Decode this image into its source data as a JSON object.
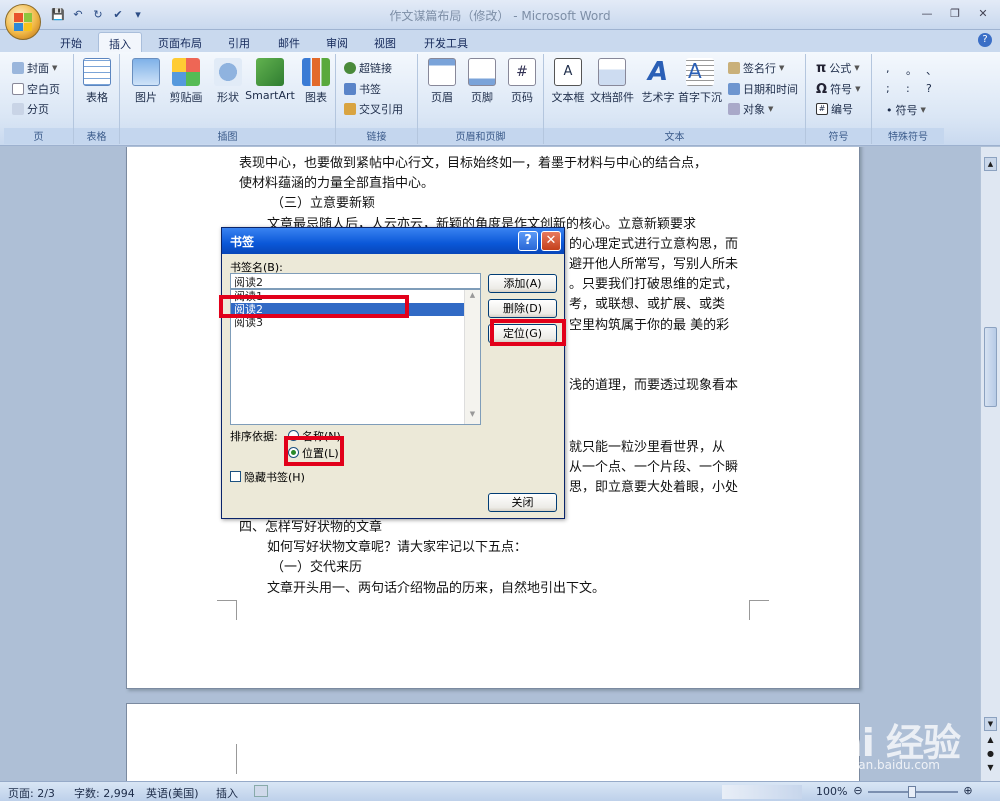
{
  "window": {
    "title": "作文谋篇布局（修改） - Microsoft Word"
  },
  "tabs": [
    "开始",
    "插入",
    "页面布局",
    "引用",
    "邮件",
    "审阅",
    "视图",
    "开发工具"
  ],
  "ribbon": {
    "page_group": {
      "label": "页",
      "items": [
        "封面",
        "空白页",
        "分页"
      ]
    },
    "table_group": {
      "label": "表格",
      "button": "表格"
    },
    "illustrations_group": {
      "label": "插图",
      "buttons": [
        "图片",
        "剪贴画",
        "形状",
        "SmartArt",
        "图表"
      ]
    },
    "links_group": {
      "label": "链接",
      "items": [
        "超链接",
        "书签",
        "交叉引用"
      ]
    },
    "header_footer_group": {
      "label": "页眉和页脚",
      "buttons": [
        "页眉",
        "页脚",
        "页码"
      ]
    },
    "text_group": {
      "label": "文本",
      "buttons": [
        "文本框",
        "文档部件",
        "艺术字",
        "首字下沉"
      ],
      "items": [
        "签名行",
        "日期和时间",
        "对象"
      ]
    },
    "symbols_group": {
      "label": "符号",
      "items": [
        "公式",
        "符号",
        "编号"
      ]
    },
    "special_group": {
      "label": "特殊符号",
      "chars": [
        ",",
        "。",
        "、",
        ";",
        ":",
        "?",
        "符号"
      ]
    }
  },
  "document": {
    "lines": [
      "表现中心，也要做到紧帖中心行文，目标始终如一，着墨于材料与中心的结合点，",
      "使材料蕴涵的力量全部直指中心。",
      "（三）立意要新颖",
      "文章最忌随人后，人云亦云，新颖的角度是作文创新的核心。立意新颖要求",
      "的心理定式进行立意构思，而",
      "避开他人所常写，写别人所未",
      "。只要我们打破思维的定式，",
      "考，或联想、或扩展、或类",
      "空里构筑属于你的最 美的彩",
      "浅的道理，而要透过现象看本",
      "就只能一粒沙里看世界，从",
      "从一个点、一个片段、一个瞬",
      "思，即立意要大处着眼，小处",
      "四、怎样写好状物的文章",
      "如何写好状物文章呢？请大家牢记以下五点：",
      "（一）交代来历",
      "文章开头用一、两句话介绍物品的历来，自然地引出下文。"
    ]
  },
  "dialog": {
    "title": "书签",
    "name_label": "书签名(B):",
    "name_value": "阅读2",
    "list": [
      "阅读1",
      "阅读2",
      "阅读3"
    ],
    "selected_index": 1,
    "buttons": {
      "add": "添加(A)",
      "delete": "删除(D)",
      "goto": "定位(G)",
      "close": "关闭"
    },
    "sort_label": "排序依据:",
    "sort_options": [
      "名称(N)",
      "位置(L)"
    ],
    "sort_selected": "位置(L)",
    "hidden_checkbox": "隐藏书签(H)"
  },
  "status": {
    "page": "页面: 2/3",
    "words": "字数: 2,994",
    "language": "英语(美国)",
    "mode": "插入",
    "zoom": "100%"
  },
  "watermark": {
    "brand": "Bai 经验",
    "url": "jingyan.baidu.com"
  },
  "colors": {
    "highlight": "#e2001a",
    "title_bar": "#0a57d8",
    "selection": "#316ac5"
  }
}
